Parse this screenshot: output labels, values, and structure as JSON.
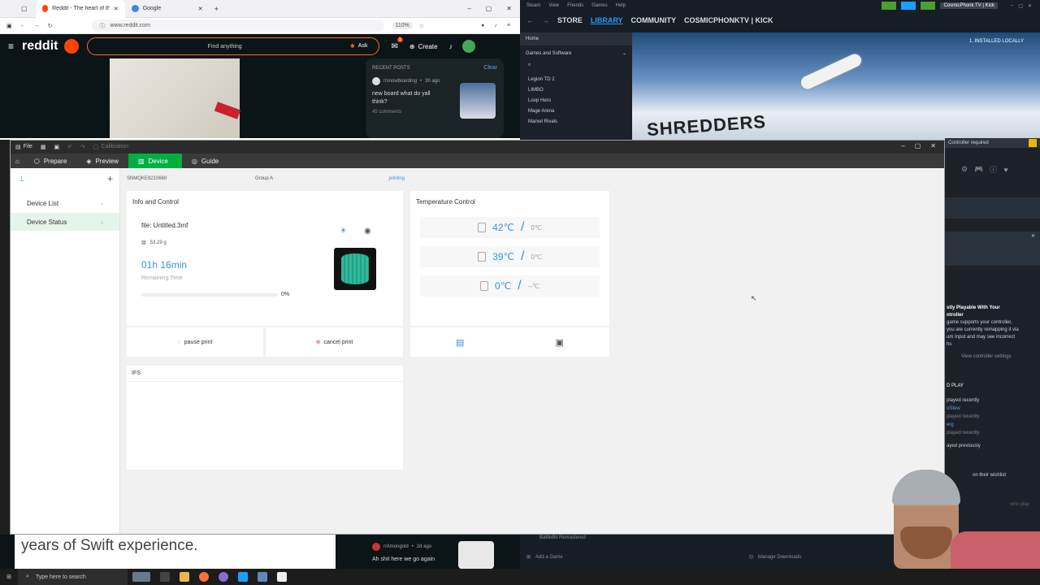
{
  "browser": {
    "tabs": [
      {
        "label": "Reddit - The heart of the intern"
      },
      {
        "label": "Google"
      }
    ],
    "url": "www.reddit.com",
    "zoom": "110%"
  },
  "reddit": {
    "logo": "reddit",
    "search_placeholder": "Find anything",
    "ask_label": "Ask",
    "create_label": "Create",
    "notif_count": "1",
    "recent_posts_title": "RECENT POSTS",
    "clear_label": "Clear",
    "posts": [
      {
        "sub": "r/snowboarding",
        "time": "3h ago",
        "title": "new board what do yall think?",
        "meta": "45 comments"
      },
      {
        "sub": "r/Amongold",
        "time": "2d ago",
        "title": "Ah shit here we go again",
        "meta": ""
      }
    ],
    "video_caption": "years of Swift experience."
  },
  "steam": {
    "topmenu": [
      "Steam",
      "View",
      "Friends",
      "Games",
      "Help"
    ],
    "nav": [
      "STORE",
      "LIBRARY",
      "COMMUNITY",
      "COSMICPHONKTV | KICK"
    ],
    "account": "CosmicPhonk TV | Kick",
    "home": "Home",
    "filter": "Games and Software",
    "games": [
      "Legion TD 2",
      "LIMBO",
      "Loop Hero",
      "Mage Arena",
      "Marvel Rivals"
    ],
    "installed_badge": "1. INSTALLED LOCALLY",
    "hero_title": "SHREDDERS",
    "controller_required": "Controller required",
    "side_panel": {
      "heading_1": "stly Playable With Your",
      "heading_2": "ntroller",
      "desc_1": "game supports your controller,",
      "desc_2": "you are currently remapping it via",
      "desc_3": "um Input and may see incorrect",
      "desc_4": "hs",
      "view_settings": "View controller settings",
      "play_label": "D PLAY",
      "played_recently": "played recently",
      "friend_1": "oStew",
      "friend_1_sub": "played recently",
      "friend_2": "erg",
      "friend_2_sub": "played recently",
      "played_previously": "ayed previously",
      "wishlist": "on their wishlist",
      "who_play": "who play"
    },
    "bottom_game": "BattleBit Remastered",
    "add_game": "Add a Game",
    "manage_downloads": "Manage Downloads"
  },
  "app": {
    "menu_file": "File",
    "calibration": "Calibration",
    "tabs": [
      "Prepare",
      "Preview",
      "Device",
      "Guide"
    ],
    "sidebar": [
      {
        "label": "Device List"
      },
      {
        "label": "Device Status"
      }
    ],
    "device": {
      "serial": "SNMQKE9210660",
      "group": "Group A",
      "status": "printing"
    },
    "info": {
      "title": "Info and Control",
      "file": "file: Untitled.3mf",
      "weight": "53.29 g",
      "remaining": "01h 16min",
      "remaining_label": "Remaining Time",
      "progress_text": "0%",
      "progress": 0,
      "pause_label": "pause print",
      "cancel_label": "cancel print"
    },
    "temperature": {
      "title": "Temperature  Control",
      "rows": [
        {
          "icon": "nozzle-icon",
          "current": "42℃",
          "target": "0℃"
        },
        {
          "icon": "bed-icon",
          "current": "39℃",
          "target": "0℃"
        },
        {
          "icon": "chamber-icon",
          "current": "0℃",
          "target": "--℃"
        }
      ]
    },
    "ifs_title": "IFS"
  },
  "taskbar": {
    "search": "Type here to search"
  },
  "colors": {
    "accent_green": "#00ae42",
    "temp_blue": "#3795d8",
    "steam_bg": "#171d25",
    "reddit_orange": "#ff4500"
  }
}
